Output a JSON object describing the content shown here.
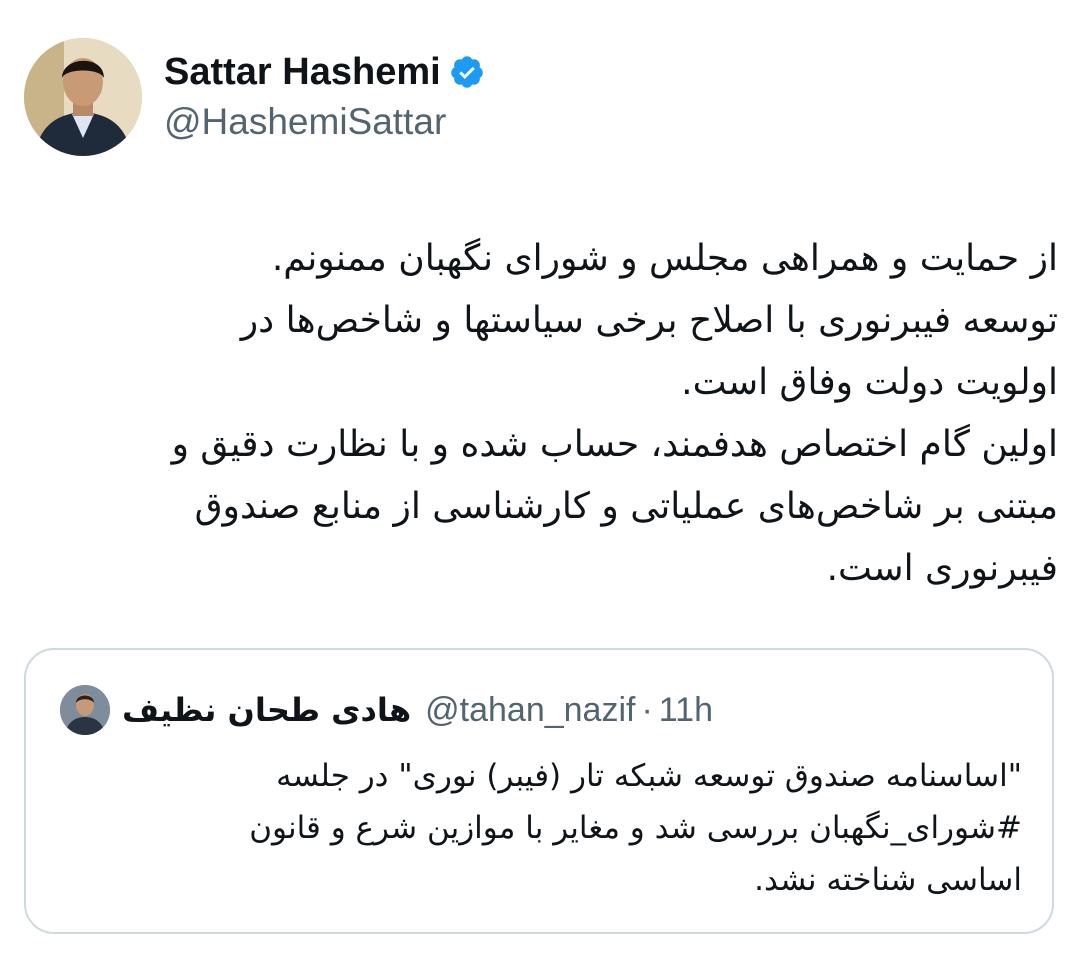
{
  "author": {
    "display_name": "Sattar Hashemi",
    "handle": "@HashemiSattar",
    "verified": true,
    "avatar_icon": "user-photo-icon",
    "verified_color": "#1d9bf0"
  },
  "tweet": {
    "lines": [
      "از حمایت و همراهی مجلس و شورای نگهبان ممنونم.",
      "توسعه فیبرنوری با اصلاح برخی سیاستها و شاخص‌ها در",
      "اولویت دولت وفاق است.",
      "اولین گام اختصاص هدفمند، حساب شده و با نظارت دقیق و",
      "مبتنی بر شاخص‌های عملیاتی و کارشناسی از منابع صندوق",
      "فیبرنوری است."
    ]
  },
  "quoted_tweet": {
    "display_name": "هادی طحان نظیف",
    "handle": "@tahan_nazif",
    "separator": "·",
    "time": "11h",
    "lines": [
      "\"اساسنامه صندوق توسعه شبکه تار (فیبر) نوری\" در جلسه",
      "#شورای_نگهبان بررسی شد و مغایر با موازین شرع و قانون",
      "اساسی شناخته نشد."
    ]
  }
}
